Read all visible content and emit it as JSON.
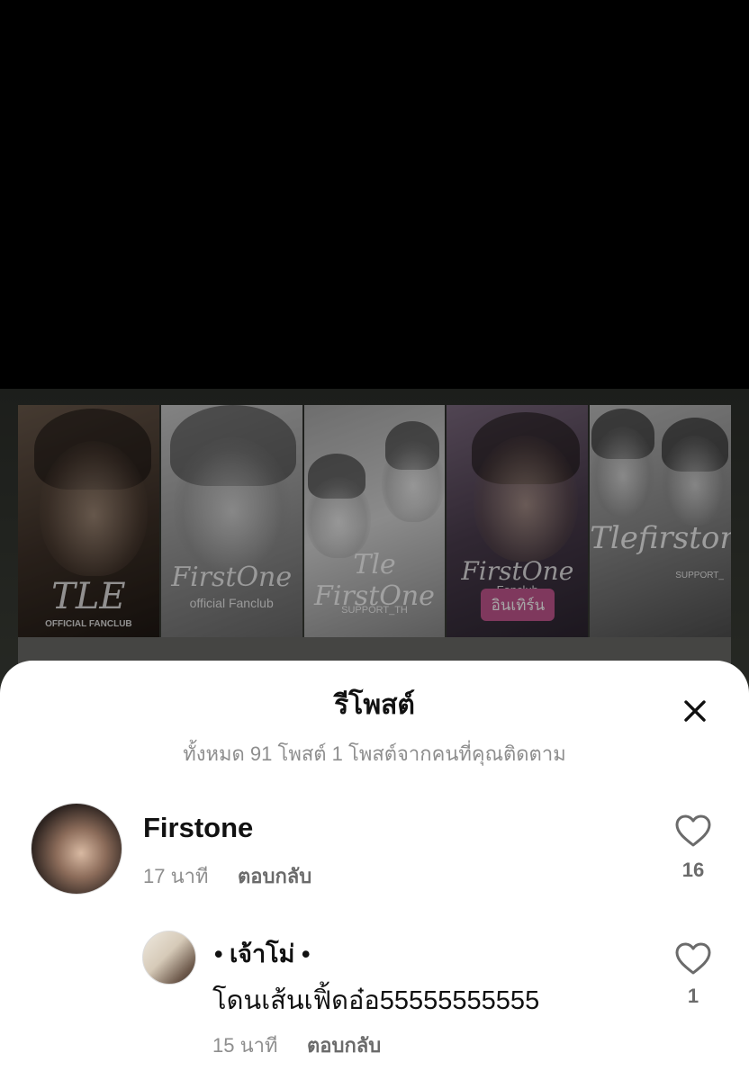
{
  "background_post": {
    "panels": [
      {
        "script": "TLE",
        "caption": "OFFICIAL FANCLUB"
      },
      {
        "script": "FirstOne",
        "caption": "official Fanclub"
      },
      {
        "script": "Tle FirstOne",
        "caption": "SUPPORT_TH"
      },
      {
        "script": "FirstOne",
        "caption": "Fanclub",
        "badge": "อินเทิร์น"
      },
      {
        "script": "Tlefirstone",
        "caption": "SUPPORT_"
      }
    ]
  },
  "sheet": {
    "title": "รีโพสต์",
    "subtitle": "ทั้งหมด 91 โพสต์ 1 โพสต์จากคนที่คุณติดตาม"
  },
  "reposts": [
    {
      "username": "Firstone",
      "time": "17 นาที",
      "reply_label": "ตอบกลับ",
      "likes": "16"
    },
    {
      "username": "• เจ้าโม่ •",
      "text": "โดนเส้นเฟิ้ดอ๋อ55555555555",
      "time": "15 นาที",
      "reply_label": "ตอบกลับ",
      "likes": "1"
    }
  ],
  "colors": {
    "sheet_bg": "#ffffff",
    "badge": "#c4578f",
    "muted_text": "#8e8e8e"
  }
}
